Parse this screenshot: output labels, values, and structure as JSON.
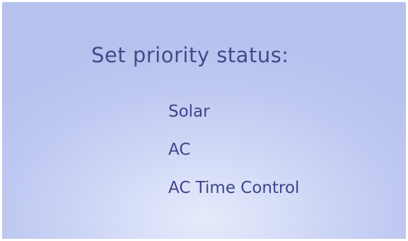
{
  "screen": {
    "title": "Set priority status:",
    "options": [
      {
        "label": "Solar"
      },
      {
        "label": "AC"
      },
      {
        "label": "AC Time Control"
      }
    ]
  },
  "colors": {
    "background": "#c2cbf2",
    "background_light": "#e6ebfb",
    "text": "#45498a"
  }
}
